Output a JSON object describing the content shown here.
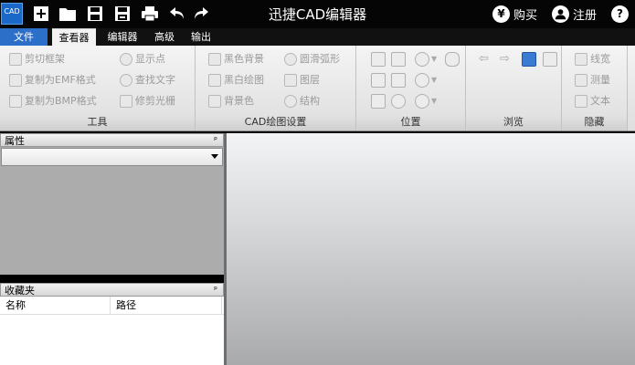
{
  "app": {
    "title": "迅捷CAD编辑器",
    "logo_text": "CAD"
  },
  "titlebar": {
    "buy_label": "购买",
    "register_label": "注册",
    "buy_icon_char": "¥",
    "help_icon_char": "?"
  },
  "menu": {
    "tabs": [
      "文件",
      "查看器",
      "编辑器",
      "高级",
      "输出"
    ]
  },
  "ribbon": {
    "tools": {
      "label": "工具",
      "items": [
        "剪切框架",
        "复制为EMF格式",
        "复制为BMP格式",
        "显示点",
        "查找文字",
        "修剪光栅"
      ]
    },
    "cad_settings": {
      "label": "CAD绘图设置",
      "items": [
        "黑色背景",
        "黑白绘图",
        "背景色",
        "圆滑弧形",
        "图层",
        "结构"
      ]
    },
    "position": {
      "label": "位置"
    },
    "browse": {
      "label": "浏览"
    },
    "hide": {
      "label": "隐藏",
      "items": [
        "线宽",
        "测量",
        "文本"
      ]
    }
  },
  "panels": {
    "properties": {
      "title": "属性",
      "pin": "ᵖ",
      "combo_value": ""
    },
    "favorites": {
      "title": "收藏夹",
      "pin": "ᵖ",
      "columns": [
        "名称",
        "路径"
      ]
    }
  }
}
